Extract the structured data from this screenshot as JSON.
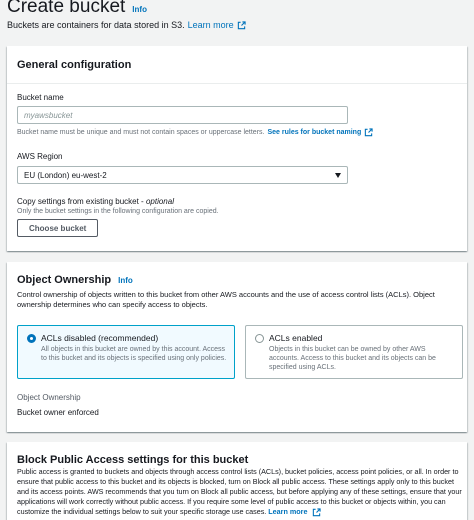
{
  "header": {
    "title": "Create bucket",
    "info": "Info",
    "description": "Buckets are containers for data stored in S3.",
    "learn_more": "Learn more"
  },
  "general": {
    "title": "General configuration",
    "bucket_name_label": "Bucket name",
    "bucket_name_value": "",
    "bucket_name_placeholder": "myawsbucket",
    "bucket_name_hint": "Bucket name must be unique and must not contain spaces or uppercase letters.",
    "bucket_name_rules_link": "See rules for bucket naming",
    "region_label": "AWS Region",
    "region_value": "EU (London) eu-west-2",
    "copy_label": "Copy settings from existing bucket - ",
    "copy_optional": "optional",
    "copy_hint": "Only the bucket settings in the following configuration are copied.",
    "choose_button": "Choose bucket"
  },
  "ownership": {
    "title": "Object Ownership",
    "info": "Info",
    "description": "Control ownership of objects written to this bucket from other AWS accounts and the use of access control lists (ACLs). Object ownership determines who can specify access to objects.",
    "options": [
      {
        "label": "ACLs disabled (recommended)",
        "description": "All objects in this bucket are owned by this account. Access to this bucket and its objects is specified using only policies.",
        "selected": true
      },
      {
        "label": "ACLs enabled",
        "description": "Objects in this bucket can be owned by other AWS accounts. Access to this bucket and its objects can be specified using ACLs.",
        "selected": false
      }
    ],
    "key_label": "Object Ownership",
    "key_value": "Bucket owner enforced"
  },
  "bpa": {
    "title": "Block Public Access settings for this bucket",
    "description": "Public access is granted to buckets and objects through access control lists (ACLs), bucket policies, access point policies, or all. In order to ensure that public access to this bucket and its objects is blocked, turn on Block all public access. These settings apply only to this bucket and its access points. AWS recommends that you turn on Block all public access, but before applying any of these settings, ensure that your applications will work correctly without public access. If you require some level of public access to this bucket or objects within, you can customize the individual settings below to suit your specific storage use cases.",
    "learn_more": "Learn more"
  },
  "colors": {
    "link": "#0073bb",
    "selected_border": "#00a1c9",
    "selected_bg": "#f1faff",
    "page_bg": "#f2f3f3"
  },
  "icons": {
    "external_link": "external-link-icon",
    "dropdown": "caret-down-icon"
  }
}
